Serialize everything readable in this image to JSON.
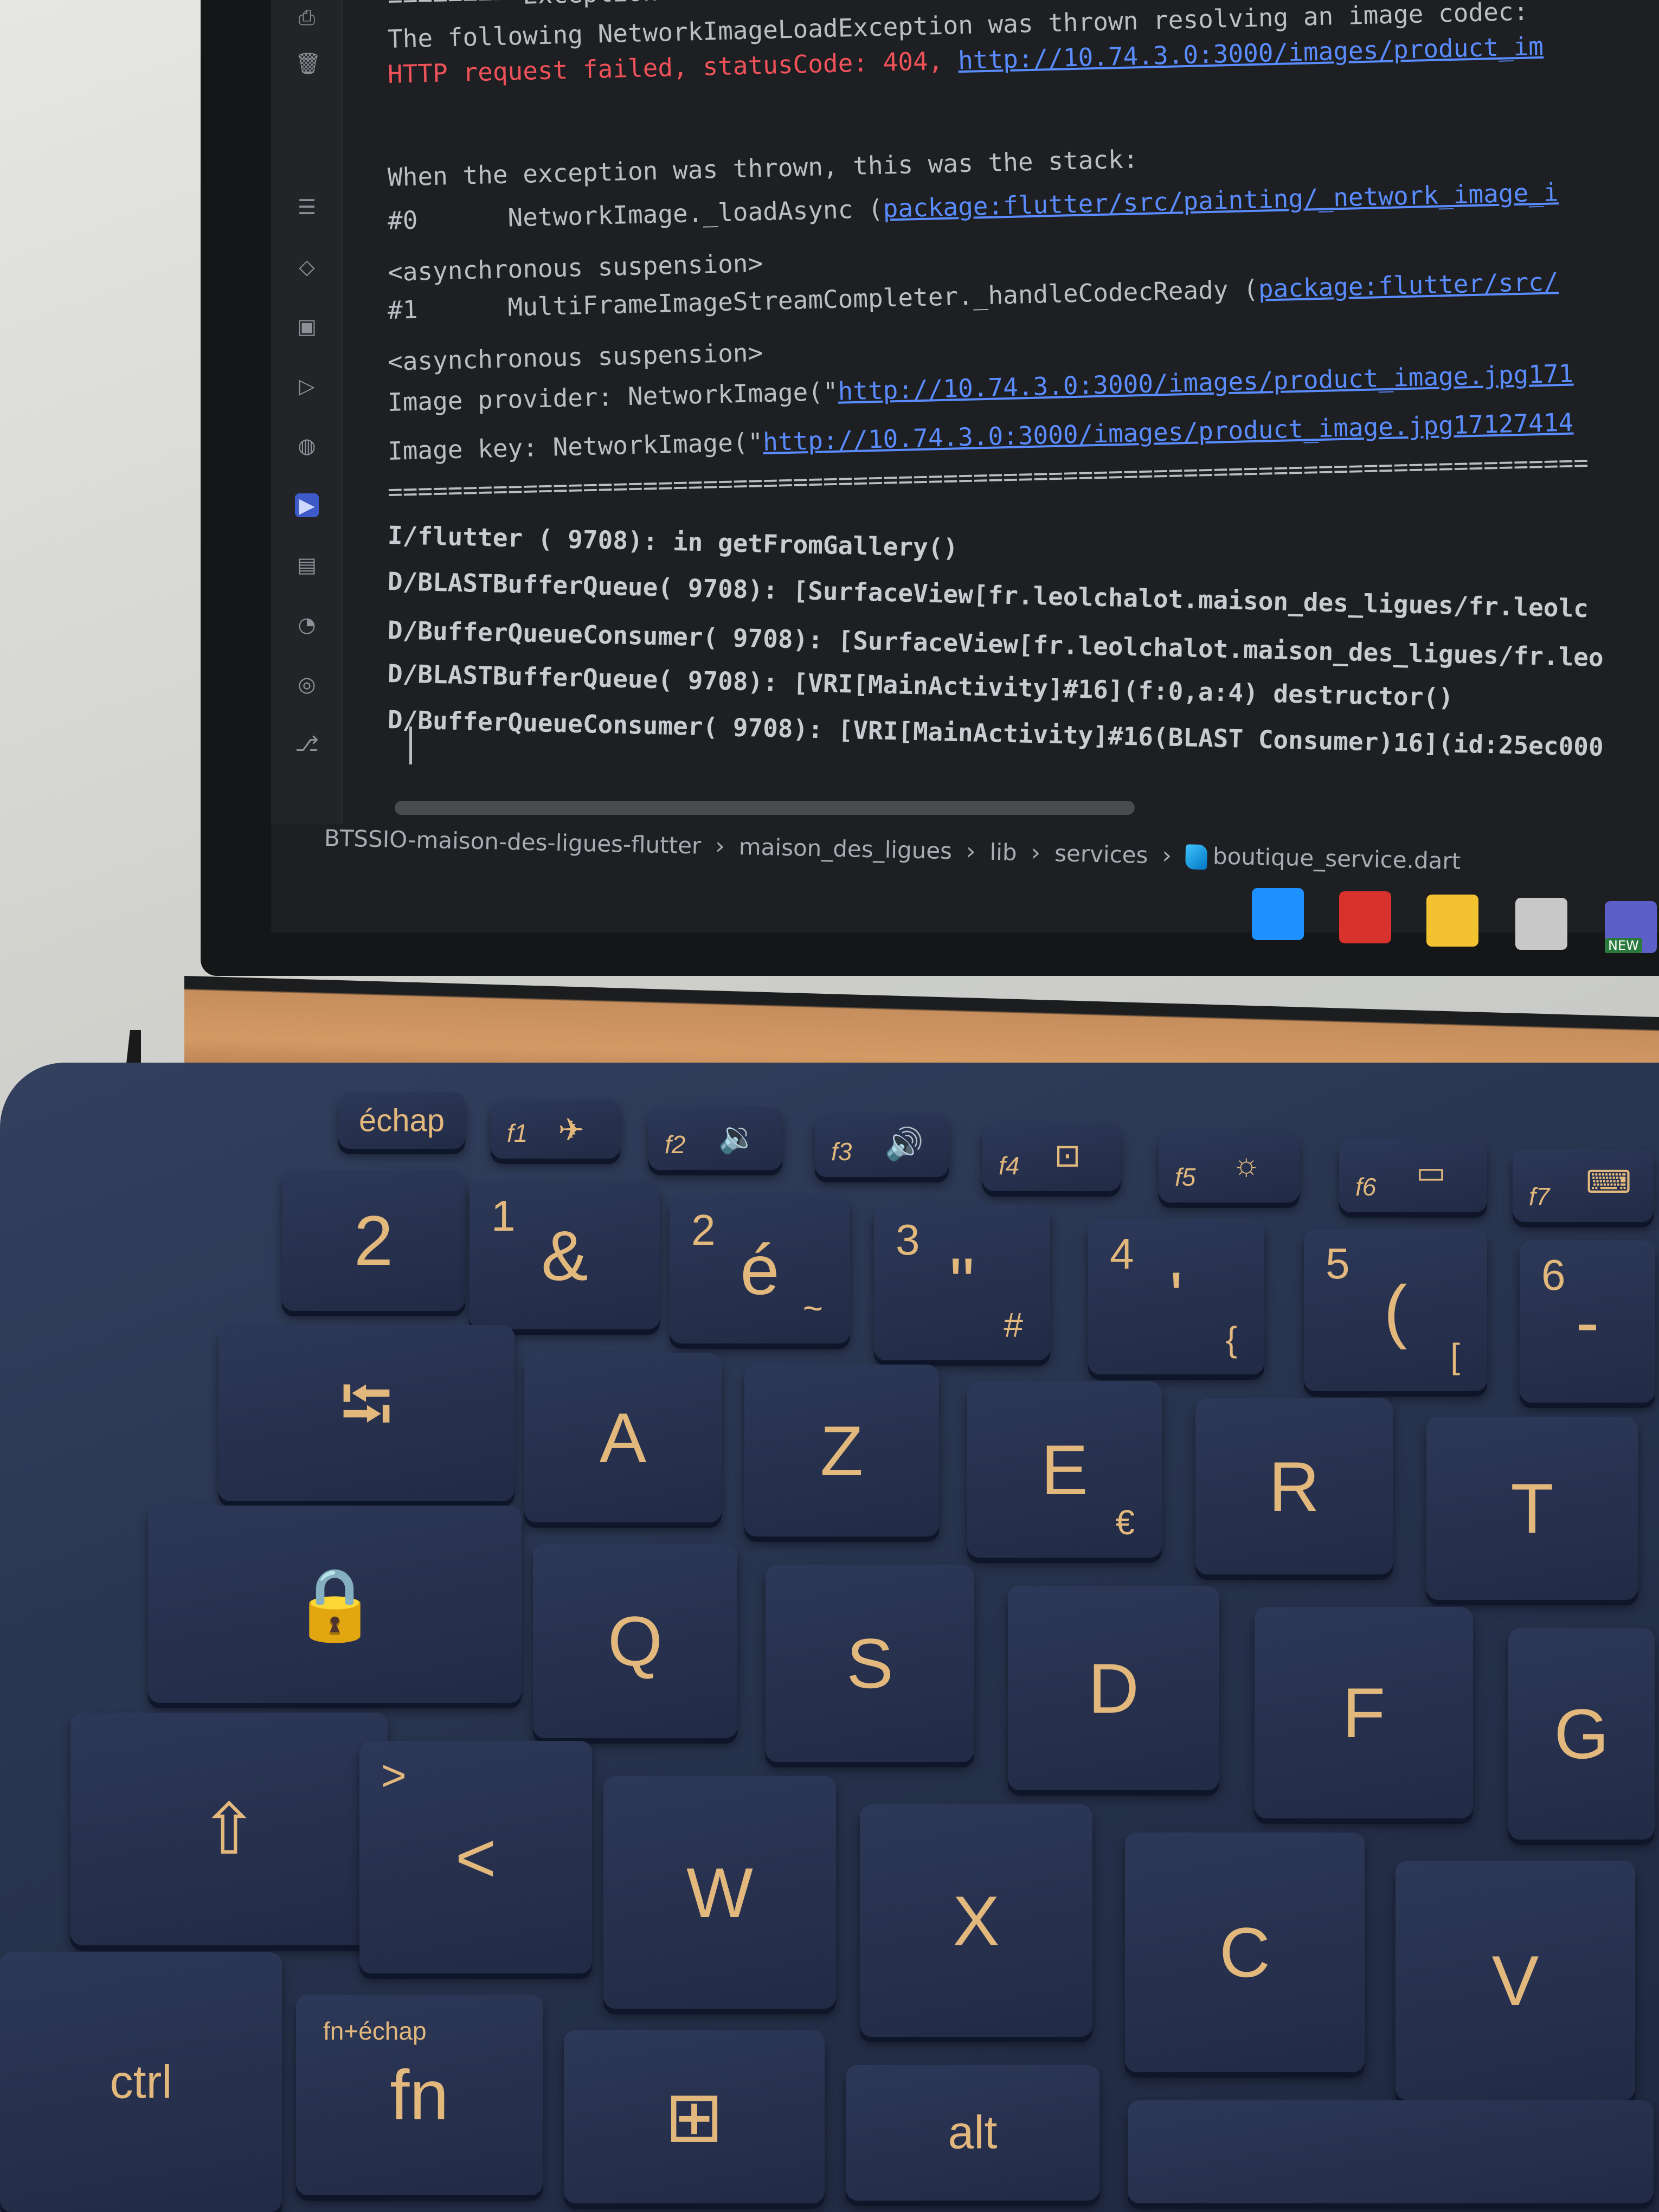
{
  "console": {
    "lines": [
      {
        "style": "normal",
        "segments": [
          {
            "t": "======== Exception",
            "c": "text"
          }
        ]
      },
      {
        "style": "normal",
        "segments": [
          {
            "t": "The following NetworkImageLoadException was thrown resolving an image codec:",
            "c": "text"
          }
        ]
      },
      {
        "style": "normal",
        "segments": [
          {
            "t": "HTTP request failed, statusCode: 404, ",
            "c": "error"
          },
          {
            "t": "http://10.74.3.0:3000/images/product_im",
            "c": "link"
          }
        ]
      },
      {
        "style": "normal",
        "segments": [
          {
            "t": "When the exception was thrown, this was the stack:",
            "c": "text"
          }
        ]
      },
      {
        "style": "normal",
        "segments": [
          {
            "t": "#0      NetworkImage._loadAsync (",
            "c": "text"
          },
          {
            "t": "package:flutter/src/painting/_network_image_i",
            "c": "link"
          }
        ]
      },
      {
        "style": "normal",
        "segments": [
          {
            "t": "<asynchronous suspension>",
            "c": "text"
          }
        ]
      },
      {
        "style": "normal",
        "segments": [
          {
            "t": "#1      MultiFrameImageStreamCompleter._handleCodecReady (",
            "c": "text"
          },
          {
            "t": "package:flutter/src/",
            "c": "link"
          }
        ]
      },
      {
        "style": "normal",
        "segments": [
          {
            "t": "<asynchronous suspension>",
            "c": "text"
          }
        ]
      },
      {
        "style": "normal",
        "segments": [
          {
            "t": "Image provider: NetworkImage(\"",
            "c": "text"
          },
          {
            "t": "http://10.74.3.0:3000/images/product_image.jpg171",
            "c": "link"
          }
        ]
      },
      {
        "style": "normal",
        "segments": [
          {
            "t": "Image key: NetworkImage(\"",
            "c": "text"
          },
          {
            "t": "http://10.74.3.0:3000/images/product_image.jpg17127414",
            "c": "link"
          }
        ]
      },
      {
        "style": "normal",
        "segments": [
          {
            "t": "================================================================================",
            "c": "text"
          }
        ]
      },
      {
        "style": "bold",
        "segments": [
          {
            "t": "I/flutter ( 9708): in getFromGallery()",
            "c": "text"
          }
        ]
      },
      {
        "style": "bold",
        "segments": [
          {
            "t": "D/BLASTBufferQueue( 9708): [SurfaceView[fr.leolchalot.maison_des_ligues/fr.leolc",
            "c": "text"
          }
        ]
      },
      {
        "style": "bold",
        "segments": [
          {
            "t": "D/BufferQueueConsumer( 9708): [SurfaceView[fr.leolchalot.maison_des_ligues/fr.leo",
            "c": "text"
          }
        ]
      },
      {
        "style": "bold",
        "segments": [
          {
            "t": "D/BLASTBufferQueue( 9708): [VRI[MainActivity]#16](f:0,a:4) destructor()",
            "c": "text"
          }
        ]
      },
      {
        "style": "bold",
        "segments": [
          {
            "t": "D/BufferQueueConsumer( 9708): [VRI[MainActivity]#16(BLAST Consumer)16](id:25ec000",
            "c": "text"
          }
        ]
      }
    ]
  },
  "breadcrumb": [
    "BTSSIO-maison-des-ligues-flutter",
    "maison_des_ligues",
    "lib",
    "services",
    "boutique_service.dart"
  ],
  "breadcrumb_separator": "›",
  "sidebar_icons": [
    "printer-icon",
    "trash-icon",
    "list-icon",
    "gem-icon",
    "device-icon",
    "play-circle-icon",
    "plugin-icon",
    "run-icon",
    "terminal-icon",
    "problems-icon",
    "services-icon",
    "git-icon"
  ],
  "taskbar_icons": [
    {
      "name": "windows-start-icon",
      "color": "#1e90ff"
    },
    {
      "name": "app-icon",
      "color": "#d9312b"
    },
    {
      "name": "file-explorer-icon",
      "color": "#f2c230"
    },
    {
      "name": "terminal-icon",
      "color": "#c8c8c8"
    },
    {
      "name": "teams-icon",
      "color": "#5b5fc7"
    }
  ],
  "taskbar_badge": "NEW",
  "keyboard": {
    "function_row": [
      {
        "main": "échap"
      },
      {
        "fn": "f1",
        "icon": "✈"
      },
      {
        "fn": "f2",
        "icon": "🔉"
      },
      {
        "fn": "f3",
        "icon": "🔊"
      },
      {
        "fn": "f4",
        "icon": "⊡"
      },
      {
        "fn": "f5",
        "icon": "☼"
      },
      {
        "fn": "f6",
        "icon": "▭"
      },
      {
        "fn": "f7",
        "icon": "⌨"
      }
    ],
    "number_row": [
      {
        "main": "2"
      },
      {
        "top": "1",
        "main": "&"
      },
      {
        "top": "2",
        "main": "é",
        "bottom": "~"
      },
      {
        "top": "3",
        "main": "\"",
        "bottom": "#"
      },
      {
        "top": "4",
        "main": "'",
        "bottom": "{"
      },
      {
        "top": "5",
        "main": "(",
        "bottom": "["
      },
      {
        "top": "6",
        "main": "-"
      }
    ],
    "azerty_row": [
      {
        "main": "⭾"
      },
      {
        "main": "A"
      },
      {
        "main": "Z"
      },
      {
        "main": "E",
        "bottom": "€"
      },
      {
        "main": "R"
      },
      {
        "main": "T"
      }
    ],
    "home_row": [
      {
        "main": "🔒"
      },
      {
        "main": "Q"
      },
      {
        "main": "S"
      },
      {
        "main": "D"
      },
      {
        "main": "F"
      },
      {
        "main": "G"
      }
    ],
    "bottom_alpha_row": [
      {
        "main": "⇧"
      },
      {
        "top": ">",
        "main": "<"
      },
      {
        "main": "W"
      },
      {
        "main": "X"
      },
      {
        "main": "C"
      },
      {
        "main": "V"
      }
    ],
    "modifier_row": [
      {
        "main": "ctrl"
      },
      {
        "top": "fn+échap",
        "main": "fn"
      },
      {
        "main": "⊞"
      },
      {
        "main": "alt"
      },
      {
        "main": ""
      }
    ]
  }
}
